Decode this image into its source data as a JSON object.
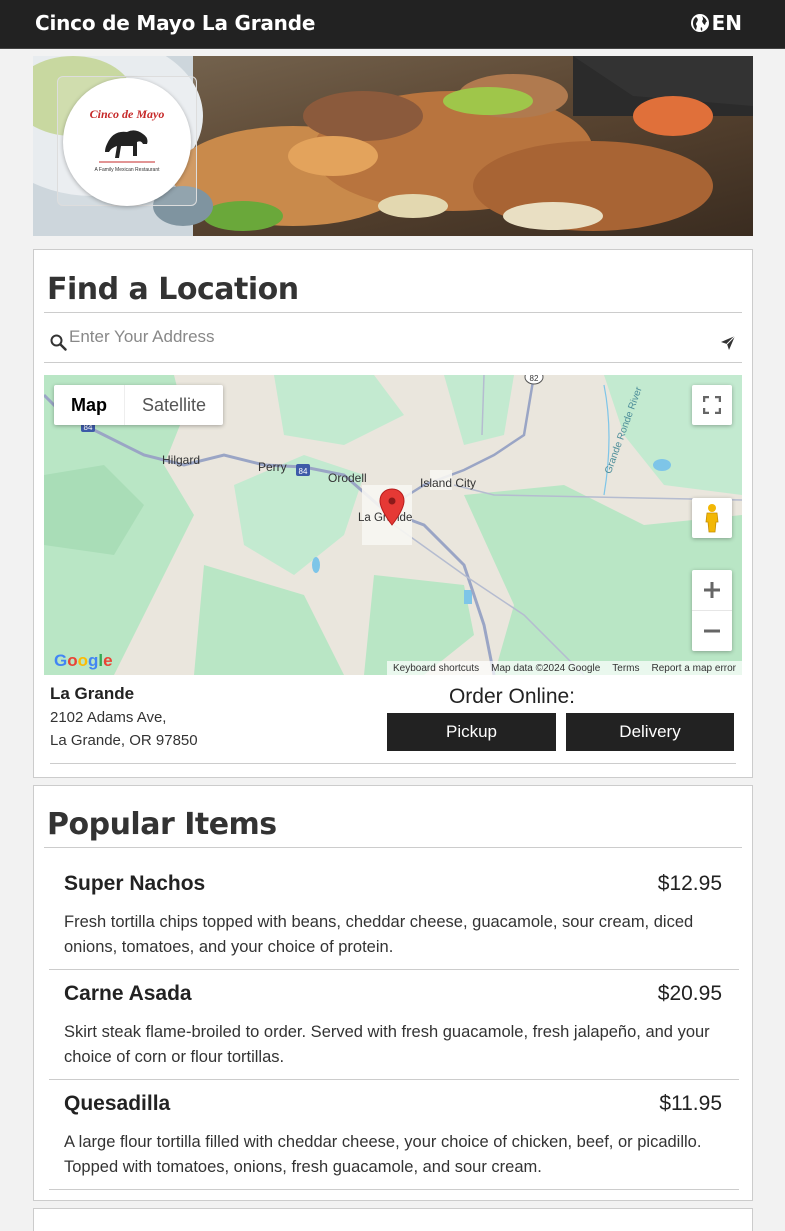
{
  "header": {
    "title": "Cinco de Mayo La Grande",
    "language": "EN"
  },
  "hero": {
    "logo_text": "Cinco de Mayo",
    "logo_subtext": "A Family Mexican Restaurant"
  },
  "find_location": {
    "heading": "Find a Location",
    "search_placeholder": "Enter Your Address",
    "map": {
      "type_map": "Map",
      "type_satellite": "Satellite",
      "labels": [
        "Hilgard",
        "Perry",
        "Orodell",
        "Island City",
        "La Grande",
        "Grande Ronde River",
        "84",
        "84",
        "82"
      ],
      "footer": [
        "Keyboard shortcuts",
        "Map data ©2024 Google",
        "Terms",
        "Report a map error"
      ],
      "google": "Google"
    },
    "location": {
      "name": "La Grande",
      "address_line1": "2102 Adams Ave,",
      "address_line2": "La Grande, OR 97850"
    },
    "order": {
      "label": "Order Online:",
      "pickup": "Pickup",
      "delivery": "Delivery"
    }
  },
  "popular": {
    "heading": "Popular Items",
    "items": [
      {
        "name": "Super Nachos",
        "price": "$12.95",
        "description": "Fresh tortilla chips topped with beans, cheddar cheese, guacamole, sour cream, diced onions, tomatoes, and your choice of protein."
      },
      {
        "name": "Carne Asada",
        "price": "$20.95",
        "description": "Skirt steak flame-broiled to order. Served with fresh guacamole, fresh jalapeño, and your choice of corn or flour tortillas."
      },
      {
        "name": "Quesadilla",
        "price": "$11.95",
        "description": "A large flour tortilla filled with cheddar cheese, your choice of chicken, beef, or picadillo. Topped with tomatoes, onions, fresh guacamole, and sour cream."
      }
    ]
  },
  "colors": {
    "topbar": "#222222",
    "button": "#222222",
    "map_green": "#b9e6c5",
    "marker": "#e53935"
  }
}
